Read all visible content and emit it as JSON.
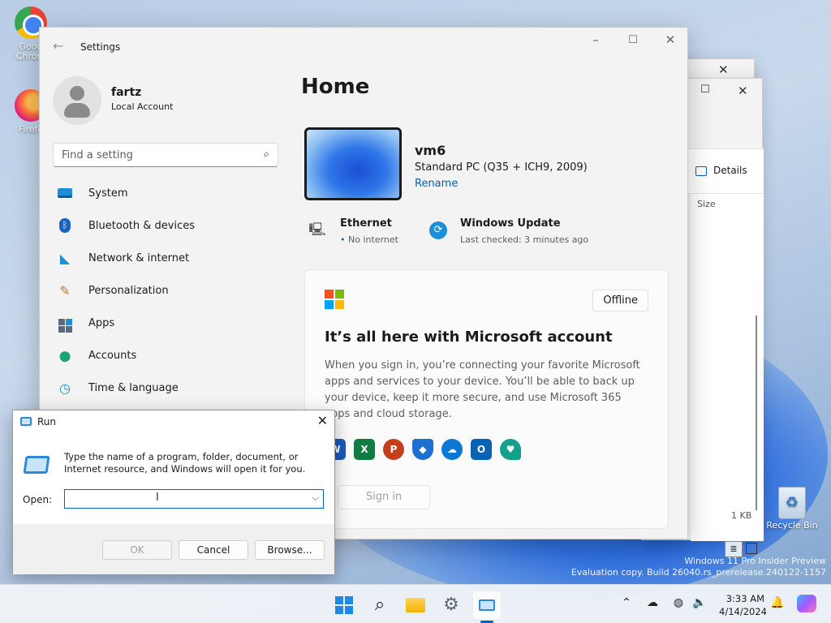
{
  "desktop": {
    "icons": [
      {
        "label": "Goog Chrom",
        "icon": "chrome-icon"
      },
      {
        "label": "Firefo",
        "icon": "firefox-icon"
      },
      {
        "label": "Recycle Bin",
        "icon": "recycle-bin-icon"
      }
    ],
    "watermark_line1": "Windows 11 Pro Insider Preview",
    "watermark_line2": "Evaluation copy. Build 26040.rs_prerelease.240122-1157"
  },
  "explorer": {
    "details_label": "Details",
    "size_header": "Size",
    "size_value": "1 KB"
  },
  "settings": {
    "window_title": "Settings",
    "user": {
      "name": "fartz",
      "account": "Local Account"
    },
    "search_placeholder": "Find a setting",
    "nav": [
      {
        "label": "System",
        "icon": "system-icon"
      },
      {
        "label": "Bluetooth & devices",
        "icon": "bluetooth-icon"
      },
      {
        "label": "Network & internet",
        "icon": "wifi-icon"
      },
      {
        "label": "Personalization",
        "icon": "brush-icon"
      },
      {
        "label": "Apps",
        "icon": "apps-icon"
      },
      {
        "label": "Accounts",
        "icon": "accounts-icon"
      },
      {
        "label": "Time & language",
        "icon": "globe-clock-icon"
      }
    ],
    "page_title": "Home",
    "device": {
      "name": "vm6",
      "spec": "Standard PC (Q35 + ICH9, 2009)",
      "rename": "Rename"
    },
    "status": {
      "ethernet_title": "Ethernet",
      "ethernet_sub": "No internet",
      "update_title": "Windows Update",
      "update_sub": "Last checked: 3 minutes ago"
    },
    "ms_card": {
      "badge": "Offline",
      "title": "It’s all here with Microsoft account",
      "body": "When you sign in, you’re connecting your favorite Microsoft apps and services to your device. You’ll be able to back up your device, keep it more secure, and use Microsoft 365 apps and cloud storage.",
      "sign_in": "Sign in"
    }
  },
  "run": {
    "title": "Run",
    "description": "Type the name of a program, folder, document, or Internet resource, and Windows will open it for you.",
    "open_label": "Open:",
    "open_value": "",
    "ok": "OK",
    "cancel": "Cancel",
    "browse": "Browse..."
  },
  "taskbar": {
    "time": "3:33 AM",
    "date": "4/14/2024"
  },
  "colors": {
    "accent": "#005fb8",
    "run_focus": "#0067c0"
  }
}
